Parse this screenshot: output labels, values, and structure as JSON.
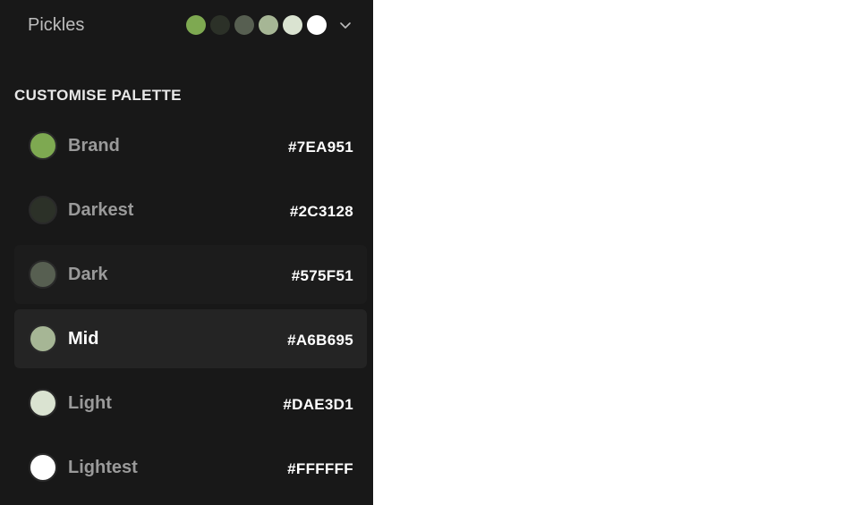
{
  "header": {
    "theme_name": "Pickles",
    "swatches": [
      {
        "icon": "swatch-brand",
        "color": "#7EA951"
      },
      {
        "icon": "swatch-darkest",
        "color": "#2C3128"
      },
      {
        "icon": "swatch-dark",
        "color": "#575F51"
      },
      {
        "icon": "swatch-mid",
        "color": "#A6B695"
      },
      {
        "icon": "swatch-light",
        "color": "#DAE3D1"
      },
      {
        "icon": "swatch-lightest",
        "color": "#FFFFFF"
      }
    ],
    "dropdown_icon": "chevron-down-icon"
  },
  "section": {
    "title": "CUSTOMISE PALETTE"
  },
  "palette": [
    {
      "label": "Brand",
      "hex": "#7EA951",
      "color": "#7EA951",
      "state": "normal"
    },
    {
      "label": "Darkest",
      "hex": "#2C3128",
      "color": "#2C3128",
      "state": "normal"
    },
    {
      "label": "Dark",
      "hex": "#575F51",
      "color": "#575F51",
      "state": "hover"
    },
    {
      "label": "Mid",
      "hex": "#A6B695",
      "color": "#A6B695",
      "state": "active"
    },
    {
      "label": "Light",
      "hex": "#DAE3D1",
      "color": "#DAE3D1",
      "state": "normal"
    },
    {
      "label": "Lightest",
      "hex": "#FFFFFF",
      "color": "#FFFFFF",
      "state": "normal"
    }
  ]
}
